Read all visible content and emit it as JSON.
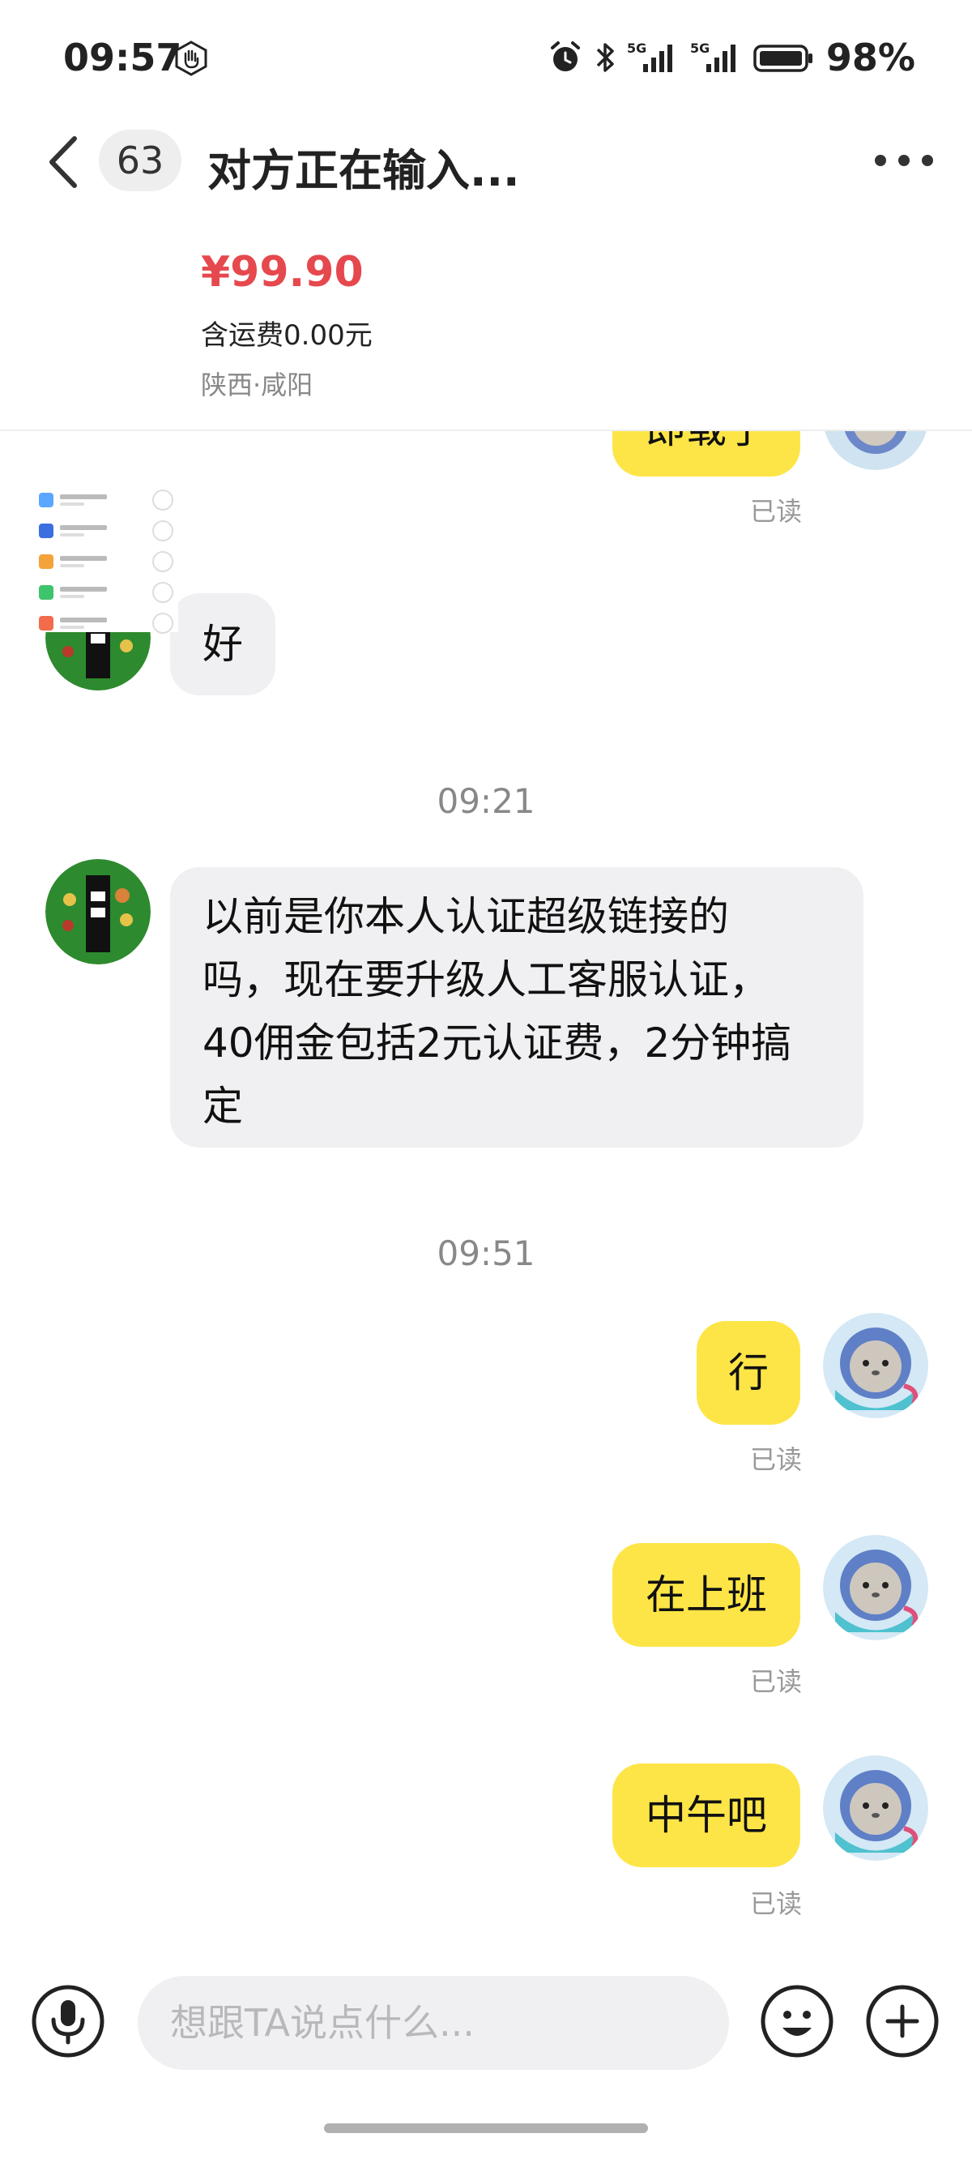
{
  "status_bar": {
    "time": "09:57",
    "battery": "98%",
    "icons": [
      "gesture-icon",
      "alarm-icon",
      "bluetooth-icon",
      "5g-signal-icon",
      "5g-signal-icon",
      "battery-icon"
    ]
  },
  "header": {
    "unread_count": "63",
    "title": "对方正在输入..."
  },
  "product": {
    "price": "¥99.90",
    "shipping": "含运费0.00元",
    "location": "陕西·咸阳"
  },
  "messages": [
    {
      "side": "out",
      "text": "即载了",
      "status": "已读"
    },
    {
      "side": "in",
      "text": "好"
    },
    {
      "timestamp": "09:21"
    },
    {
      "side": "in",
      "lines": [
        "以前是你本人认证超级链接的",
        "吗，现在要升级人工客服认证，",
        "40佣金包括2元认证费，2分钟搞",
        "定"
      ]
    },
    {
      "timestamp": "09:51"
    },
    {
      "side": "out",
      "text": "行",
      "status": "已读"
    },
    {
      "side": "out",
      "text": "在上班",
      "status": "已读"
    },
    {
      "side": "out",
      "text": "中午吧",
      "status": "已读"
    }
  ],
  "input": {
    "placeholder": "想跟TA说点什么..."
  },
  "colors": {
    "outgoing_bubble": "#fde547",
    "incoming_bubble": "#f0f0f2",
    "price": "#e5484d"
  }
}
